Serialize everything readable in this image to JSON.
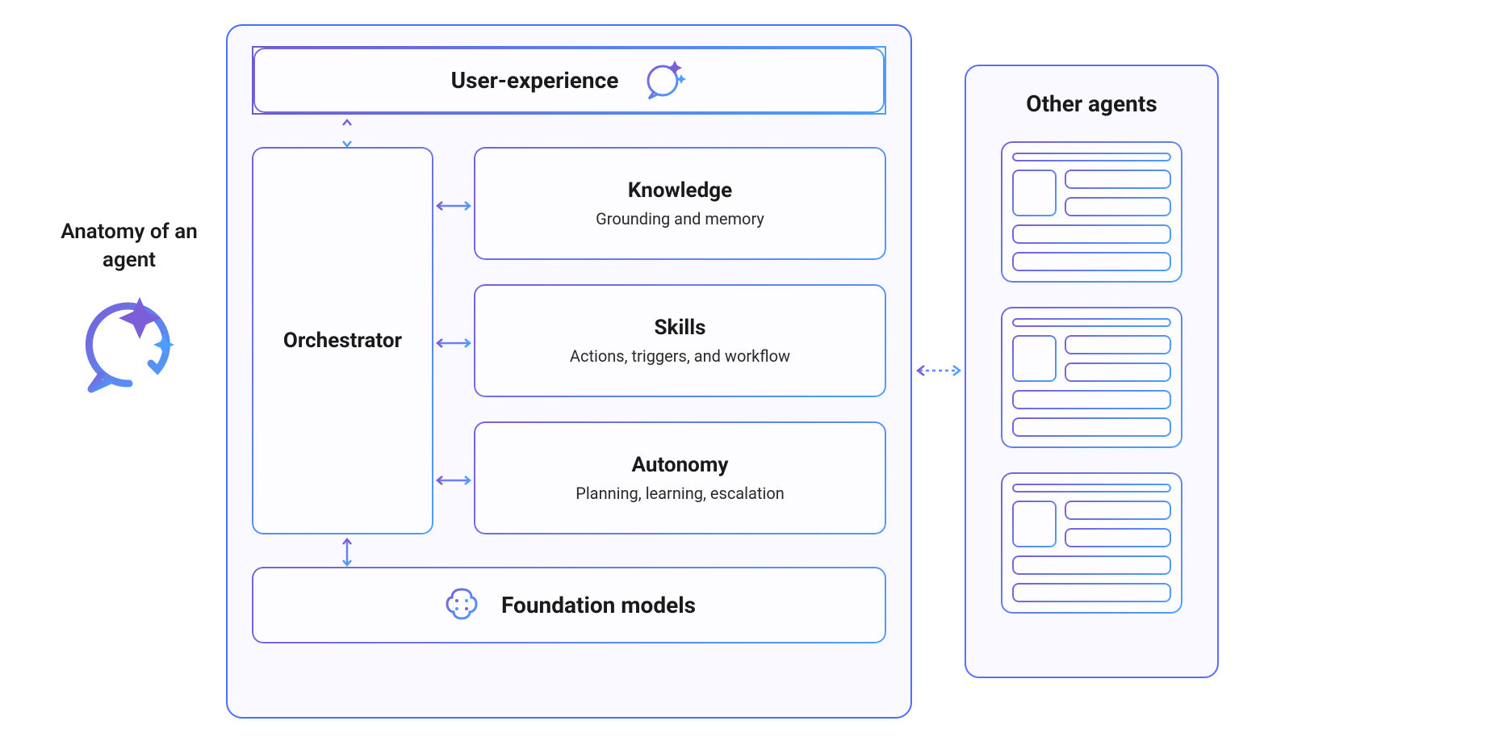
{
  "leftLabel": "Anatomy of an agent",
  "main": {
    "userExperience": "User-experience",
    "orchestrator": "Orchestrator",
    "capabilities": [
      {
        "title": "Knowledge",
        "subtitle": "Grounding and memory"
      },
      {
        "title": "Skills",
        "subtitle": "Actions, triggers, and workflow"
      },
      {
        "title": "Autonomy",
        "subtitle": "Planning, learning, escalation"
      }
    ],
    "foundation": "Foundation models"
  },
  "otherAgents": {
    "title": "Other agents"
  },
  "colors": {
    "purple": "#7a5fd8",
    "blue": "#4a9fff",
    "borderBlue": "#5a6fff"
  }
}
